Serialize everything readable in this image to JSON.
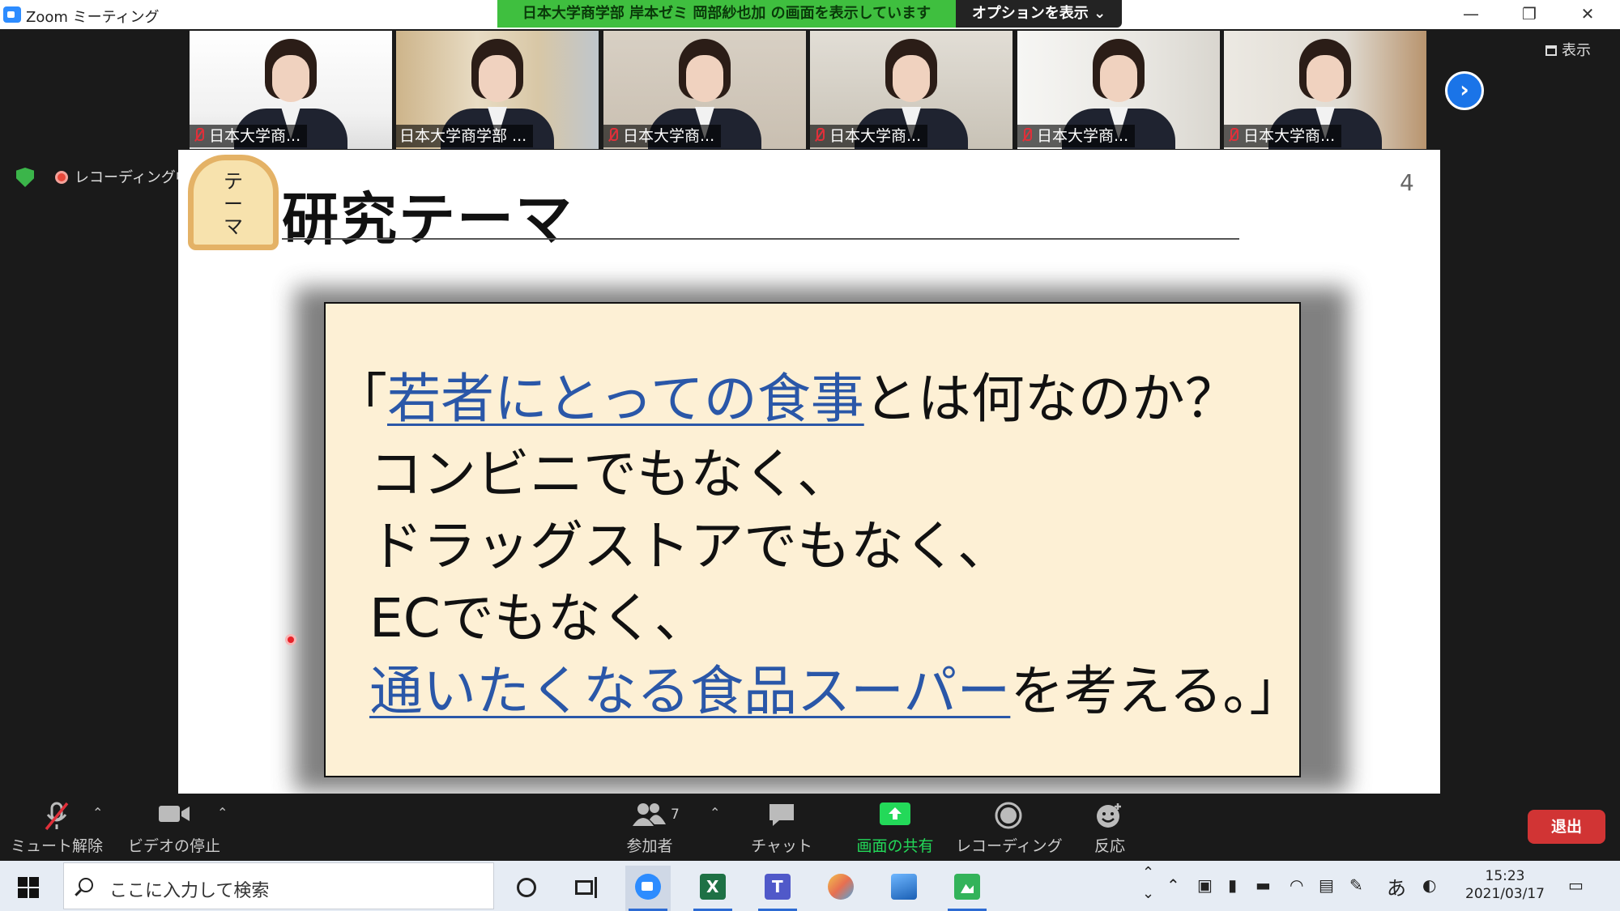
{
  "window": {
    "title": "Zoom ミーティング",
    "share_banner": "日本大学商学部 岸本ゼミ 岡部紗也加 の画面を表示しています",
    "options_label": "オプションを表示 ⌄"
  },
  "thumbnails": [
    {
      "name": "日本大学商...",
      "muted": true
    },
    {
      "name": "日本大学商学部 ...",
      "muted": false
    },
    {
      "name": "日本大学商...",
      "muted": true
    },
    {
      "name": "日本大学商...",
      "muted": true
    },
    {
      "name": "日本大学商...",
      "muted": true
    },
    {
      "name": "日本大学商...",
      "muted": true
    }
  ],
  "view_label": "表示",
  "recording_status": "レコーディング中",
  "slide": {
    "badge_text": [
      "テ",
      "ー",
      "マ"
    ],
    "title": "研究テーマ",
    "page_number": "4",
    "lines": [
      {
        "plain_before": "「",
        "emph": "若者にとっての食事",
        "plain_after": "とは何なのか？"
      },
      {
        "plain_before": "コンビニでもなく、",
        "emph": "",
        "plain_after": ""
      },
      {
        "plain_before": "ドラッグストアでもなく、",
        "emph": "",
        "plain_after": ""
      },
      {
        "plain_before": "ECでもなく、",
        "emph": "",
        "plain_after": ""
      },
      {
        "plain_before": "",
        "emph": "通いたくなる食品スーパー",
        "plain_after": "を考える。」"
      }
    ]
  },
  "controls": {
    "unmute": "ミュート解除",
    "stop_video": "ビデオの停止",
    "participants": "参加者",
    "participants_count": "7",
    "chat": "チャット",
    "share_screen": "画面の共有",
    "recording": "レコーディング",
    "reactions": "反応",
    "leave": "退出"
  },
  "taskbar": {
    "search_placeholder": "ここに入力して検索",
    "ime": "あ",
    "time": "15:23",
    "date": "2021/03/17"
  },
  "colors": {
    "share_banner": "#3fbf3f",
    "leave": "#d13434",
    "share_icon": "#23d959",
    "emphasis_text": "#2a57a8"
  }
}
